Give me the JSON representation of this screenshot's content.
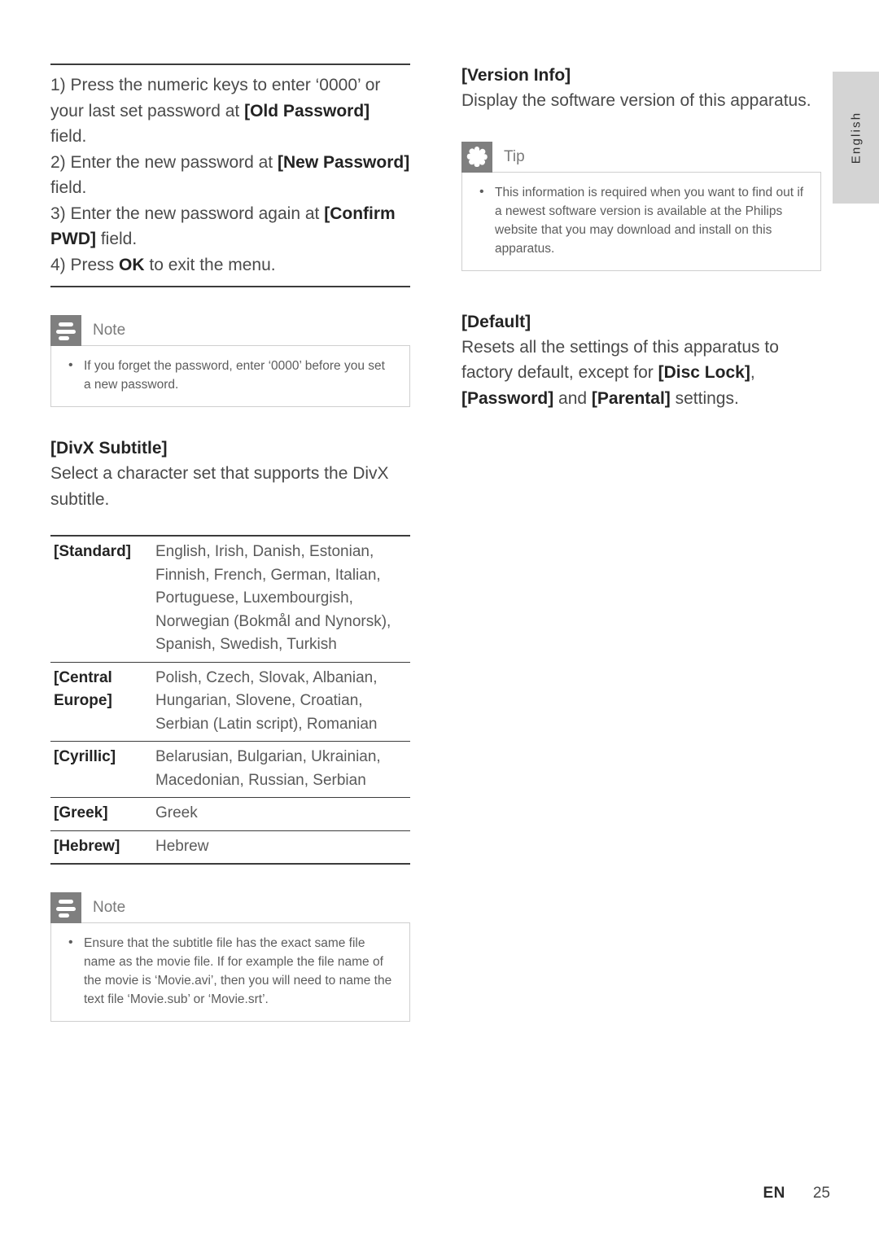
{
  "page": {
    "language_tab": "English",
    "footer_locale": "EN",
    "footer_page_number": "25",
    "accent_gray": "#7f7f7f",
    "tab_gray": "#d4d4d4",
    "rule_color": "#3c3c3c"
  },
  "left_column": {
    "steps": [
      "1) Press the numeric keys to enter ‘0000’ or your last set password at [Old Password] field.",
      "2) Enter the new password at [New Password] field.",
      "3) Enter the new password again at [Confirm PWD] field.",
      "4) Press OK to exit the menu."
    ],
    "step_1_plain_a": "1) Press the numeric keys to enter ‘0000’ or your last set password at ",
    "step_1_bold": "[Old Password]",
    "step_1_plain_b": " field.",
    "step_2_plain_a": "2) Enter the new password at ",
    "step_2_bold": "[New Password]",
    "step_2_plain_b": " field.",
    "step_3_plain_a": "3) Enter the new password again at ",
    "step_3_bold": "[Confirm PWD]",
    "step_3_plain_b": " field.",
    "step_4_plain_a": "4) Press ",
    "step_4_bold": "OK",
    "step_4_plain_b": " to exit the menu.",
    "note_password": {
      "icon": "note-lines-icon",
      "title": "Note",
      "items": [
        "If you forget the password, enter ‘0000’ before you set a new password."
      ]
    },
    "divx_heading": "[DivX Subtitle]",
    "divx_body": "Select a character set that supports the DivX subtitle.",
    "charset_table": [
      {
        "key": "[Standard]",
        "value": "English, Irish, Danish, Estonian, Finnish, French, German, Italian, Portuguese, Luxembourgish, Norwegian (Bokmål and Nynorsk), Spanish, Swedish, Turkish"
      },
      {
        "key": "[Central Europe]",
        "value": "Polish, Czech, Slovak, Albanian, Hungarian, Slovene, Croatian, Serbian (Latin script), Romanian"
      },
      {
        "key": "[Cyrillic]",
        "value": "Belarusian, Bulgarian, Ukrainian, Macedonian, Russian, Serbian"
      },
      {
        "key": "[Greek]",
        "value": "Greek"
      },
      {
        "key": "[Hebrew]",
        "value": "Hebrew"
      }
    ],
    "note_subtitle": {
      "icon": "note-lines-icon",
      "title": "Note",
      "items": [
        "Ensure that the subtitle file has the exact same file name as the movie file. If for example the file name of the movie is ‘Movie.avi’, then you will need to name the text file ‘Movie.sub’ or ‘Movie.srt’."
      ]
    }
  },
  "right_column": {
    "version_heading": "[Version Info]",
    "version_body": "Display the software version of this apparatus.",
    "tip": {
      "icon": "asterisk-icon",
      "title": "Tip",
      "items": [
        "This information is required when you want to find out if a newest software version is available at the Philips website that you may download and install on this apparatus."
      ]
    },
    "default_heading": "[Default]",
    "default_plain_a": "Resets all the settings of this apparatus to factory default, except for ",
    "default_bold_1": "[Disc Lock]",
    "default_mid": ", ",
    "default_bold_2": "[Password]",
    "default_mid_2": " and ",
    "default_bold_3": "[Parental]",
    "default_plain_b": " settings."
  }
}
